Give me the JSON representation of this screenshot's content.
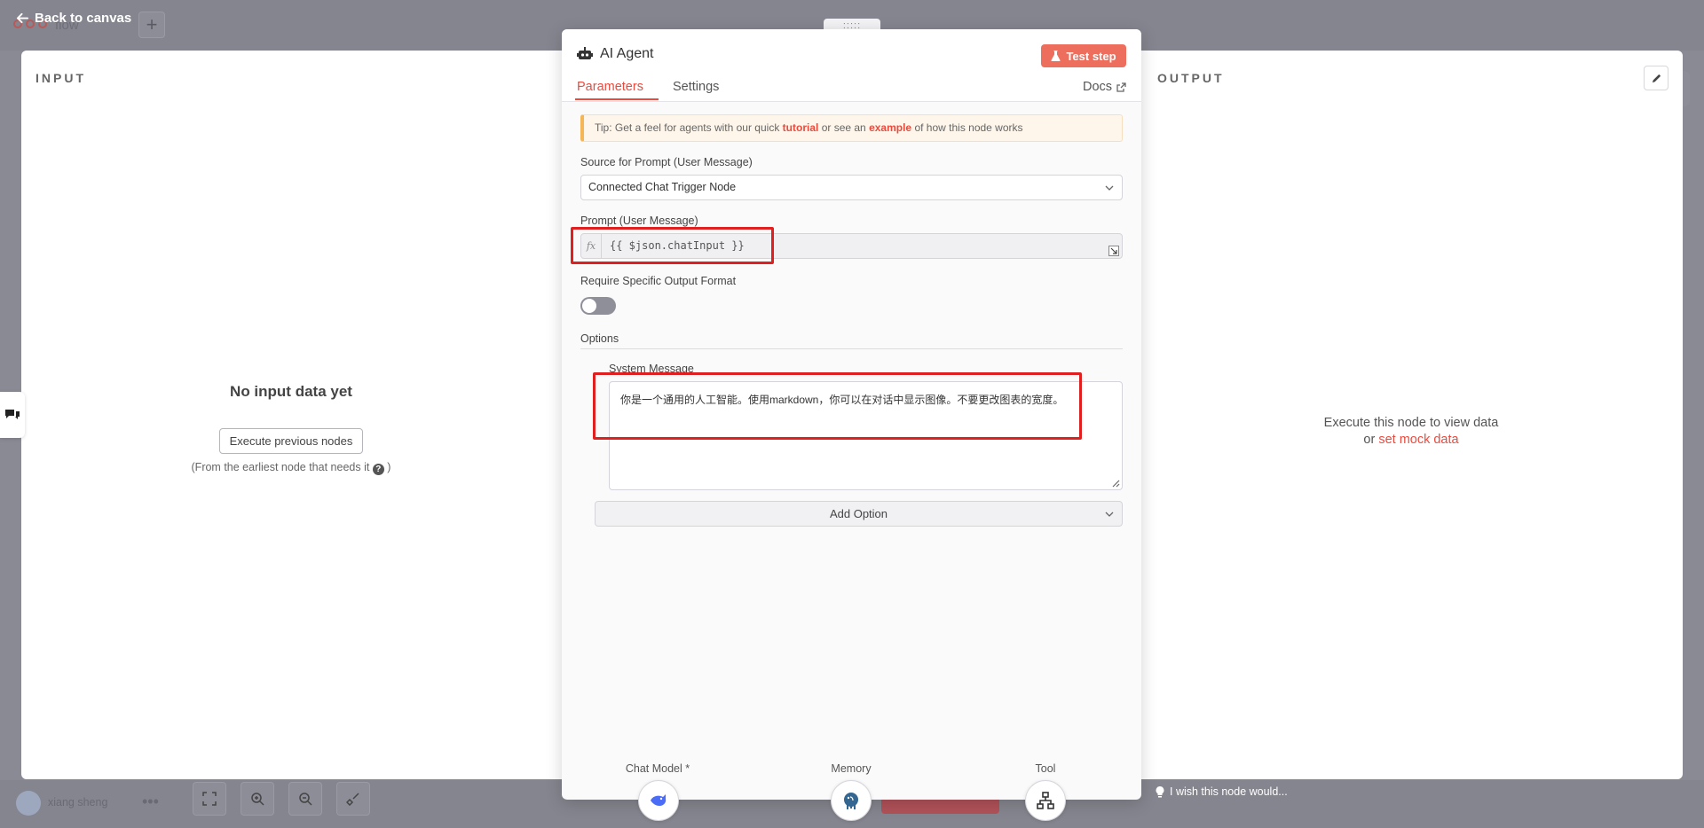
{
  "canvas": {
    "back_label": "Back to canvas",
    "workflow_name": "flow",
    "user_name": "xiang sheng",
    "dots": "•••"
  },
  "input_panel": {
    "label": "INPUT",
    "empty_title": "No input data yet",
    "execute_button": "Execute previous nodes",
    "note_prefix": "(From the earliest node that needs it",
    "note_suffix": ")"
  },
  "output_panel": {
    "label": "OUTPUT",
    "empty_line1": "Execute this node to view data",
    "empty_or": "or",
    "mock_link": "set mock data"
  },
  "node": {
    "drag_handle": ":::::",
    "title": "AI Agent",
    "test_step": "Test step",
    "tabs": [
      {
        "label": "Parameters",
        "active": true
      },
      {
        "label": "Settings",
        "active": false
      }
    ],
    "docs": "Docs",
    "tip": {
      "prefix": "Tip: Get a feel for agents with our quick",
      "tutorial": "tutorial",
      "middle": "or see an",
      "example": "example",
      "suffix": "of how this node works"
    },
    "source_label": "Source for Prompt (User Message)",
    "source_value": "Connected Chat Trigger Node",
    "prompt_label": "Prompt (User Message)",
    "prompt_fx": "fx",
    "prompt_value": "{{ $json.chatInput }}",
    "require_label": "Require Specific Output Format",
    "require_enabled": false,
    "options_label": "Options",
    "system_label": "System Message",
    "system_value": "你是一个通用的人工智能。使用markdown，你可以在对话中显示图像。不要更改图表的宽度。",
    "add_option": "Add Option"
  },
  "sub_nodes": [
    {
      "label": "Chat Model *",
      "icon": "deepseek-whale-icon"
    },
    {
      "label": "Memory",
      "icon": "postgres-elephant-icon"
    },
    {
      "label": "Tool",
      "icon": "network-tool-icon"
    }
  ],
  "footer": {
    "wish": "I wish this node would..."
  },
  "colors": {
    "accent": "#ea4b3f",
    "annotation": "#e02020"
  }
}
